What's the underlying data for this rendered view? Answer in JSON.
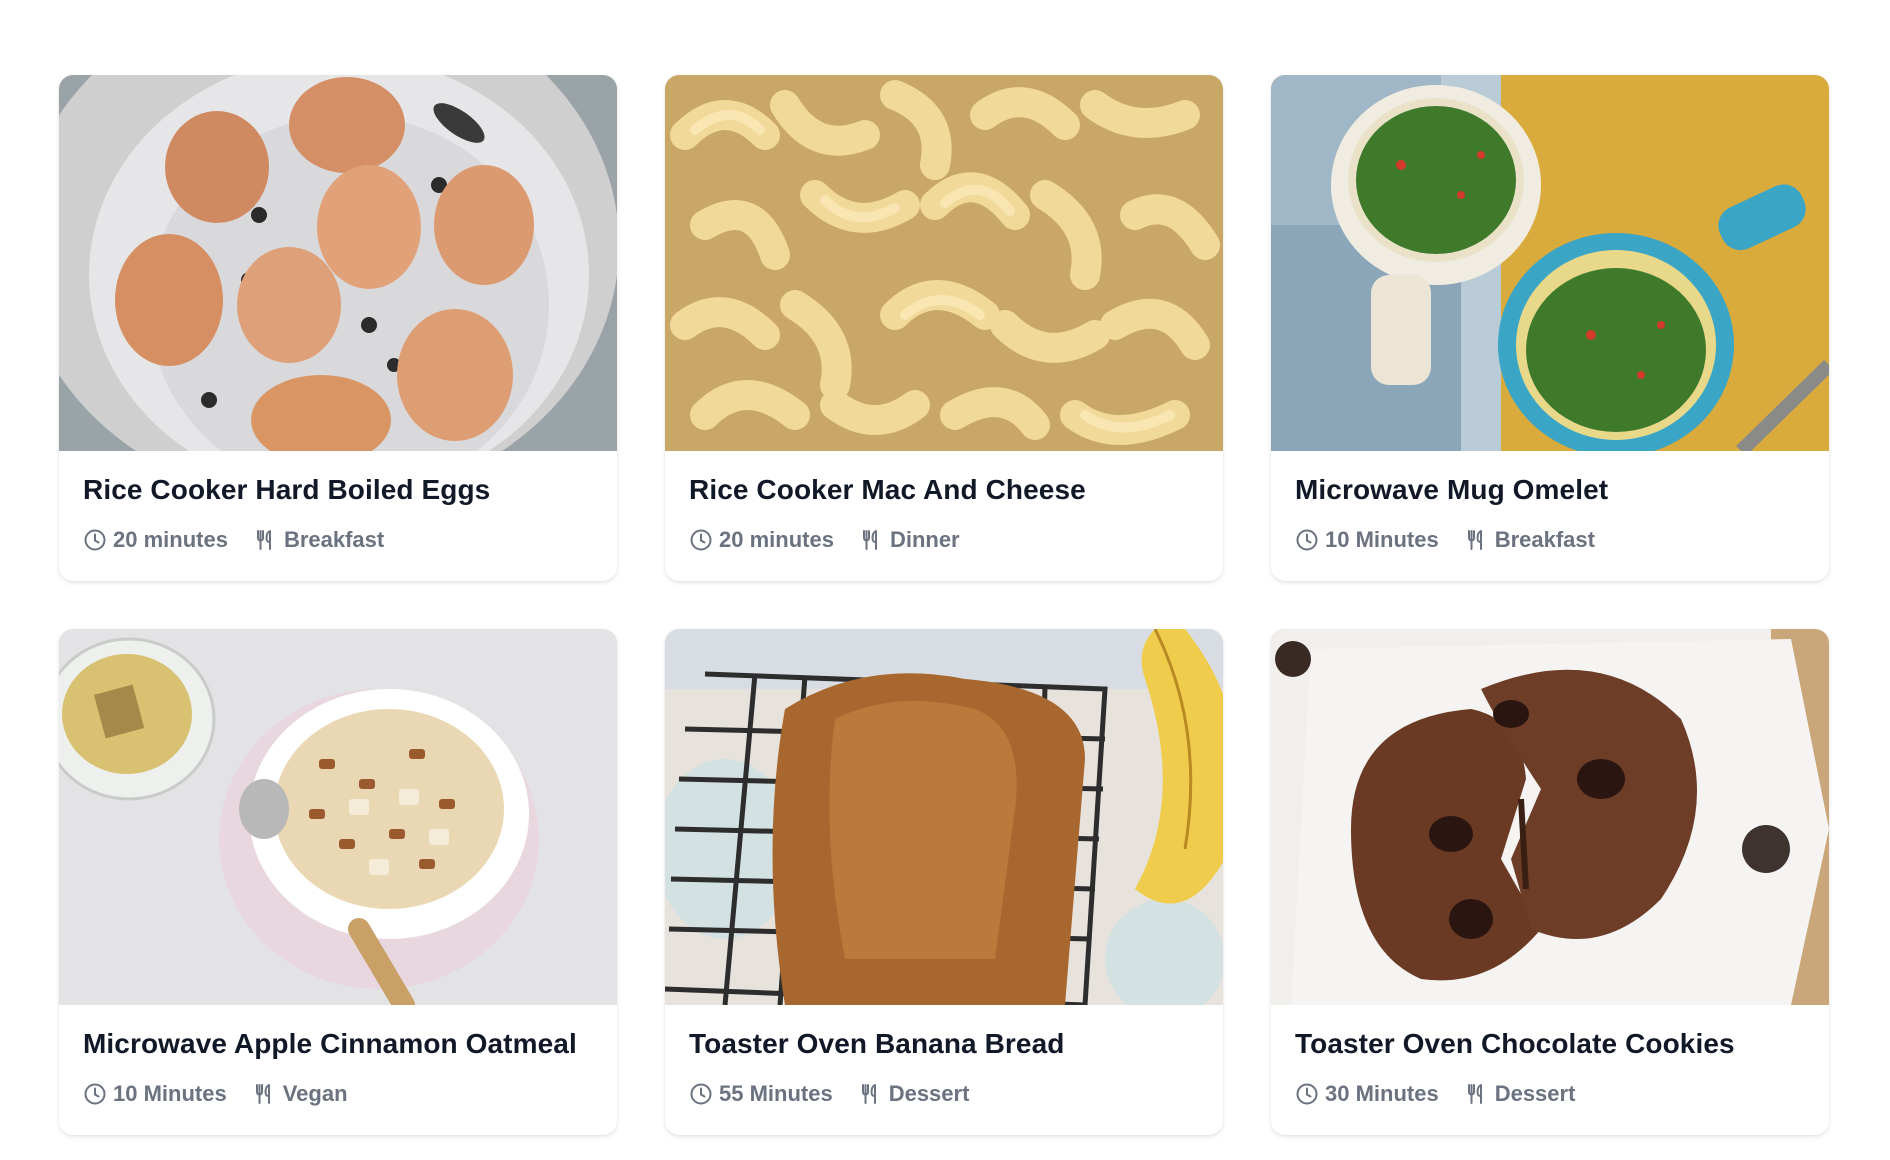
{
  "recipes": [
    {
      "title": "Rice Cooker Hard Boiled Eggs",
      "time": "20 minutes",
      "category": "Breakfast",
      "image": "eggs-in-rice-cooker-steamer"
    },
    {
      "title": "Rice Cooker Mac And Cheese",
      "time": "20 minutes",
      "category": "Dinner",
      "image": "mac-and-cheese-closeup"
    },
    {
      "title": "Microwave Mug Omelet",
      "time": "10 Minutes",
      "category": "Breakfast",
      "image": "omelet-mugs"
    },
    {
      "title": "Microwave Apple Cinnamon Oatmeal",
      "time": "10 Minutes",
      "category": "Vegan",
      "image": "oatmeal-bowl-with-tea"
    },
    {
      "title": "Toaster Oven Banana Bread",
      "time": "55 Minutes",
      "category": "Dessert",
      "image": "banana-bread-on-rack"
    },
    {
      "title": "Toaster Oven Chocolate Cookies",
      "time": "30 Minutes",
      "category": "Dessert",
      "image": "chocolate-cookie-split"
    }
  ],
  "icons": {
    "time": "clock-icon",
    "category": "utensils-icon"
  },
  "colors": {
    "meta_text": "#6b7280",
    "title_text": "#111827"
  }
}
